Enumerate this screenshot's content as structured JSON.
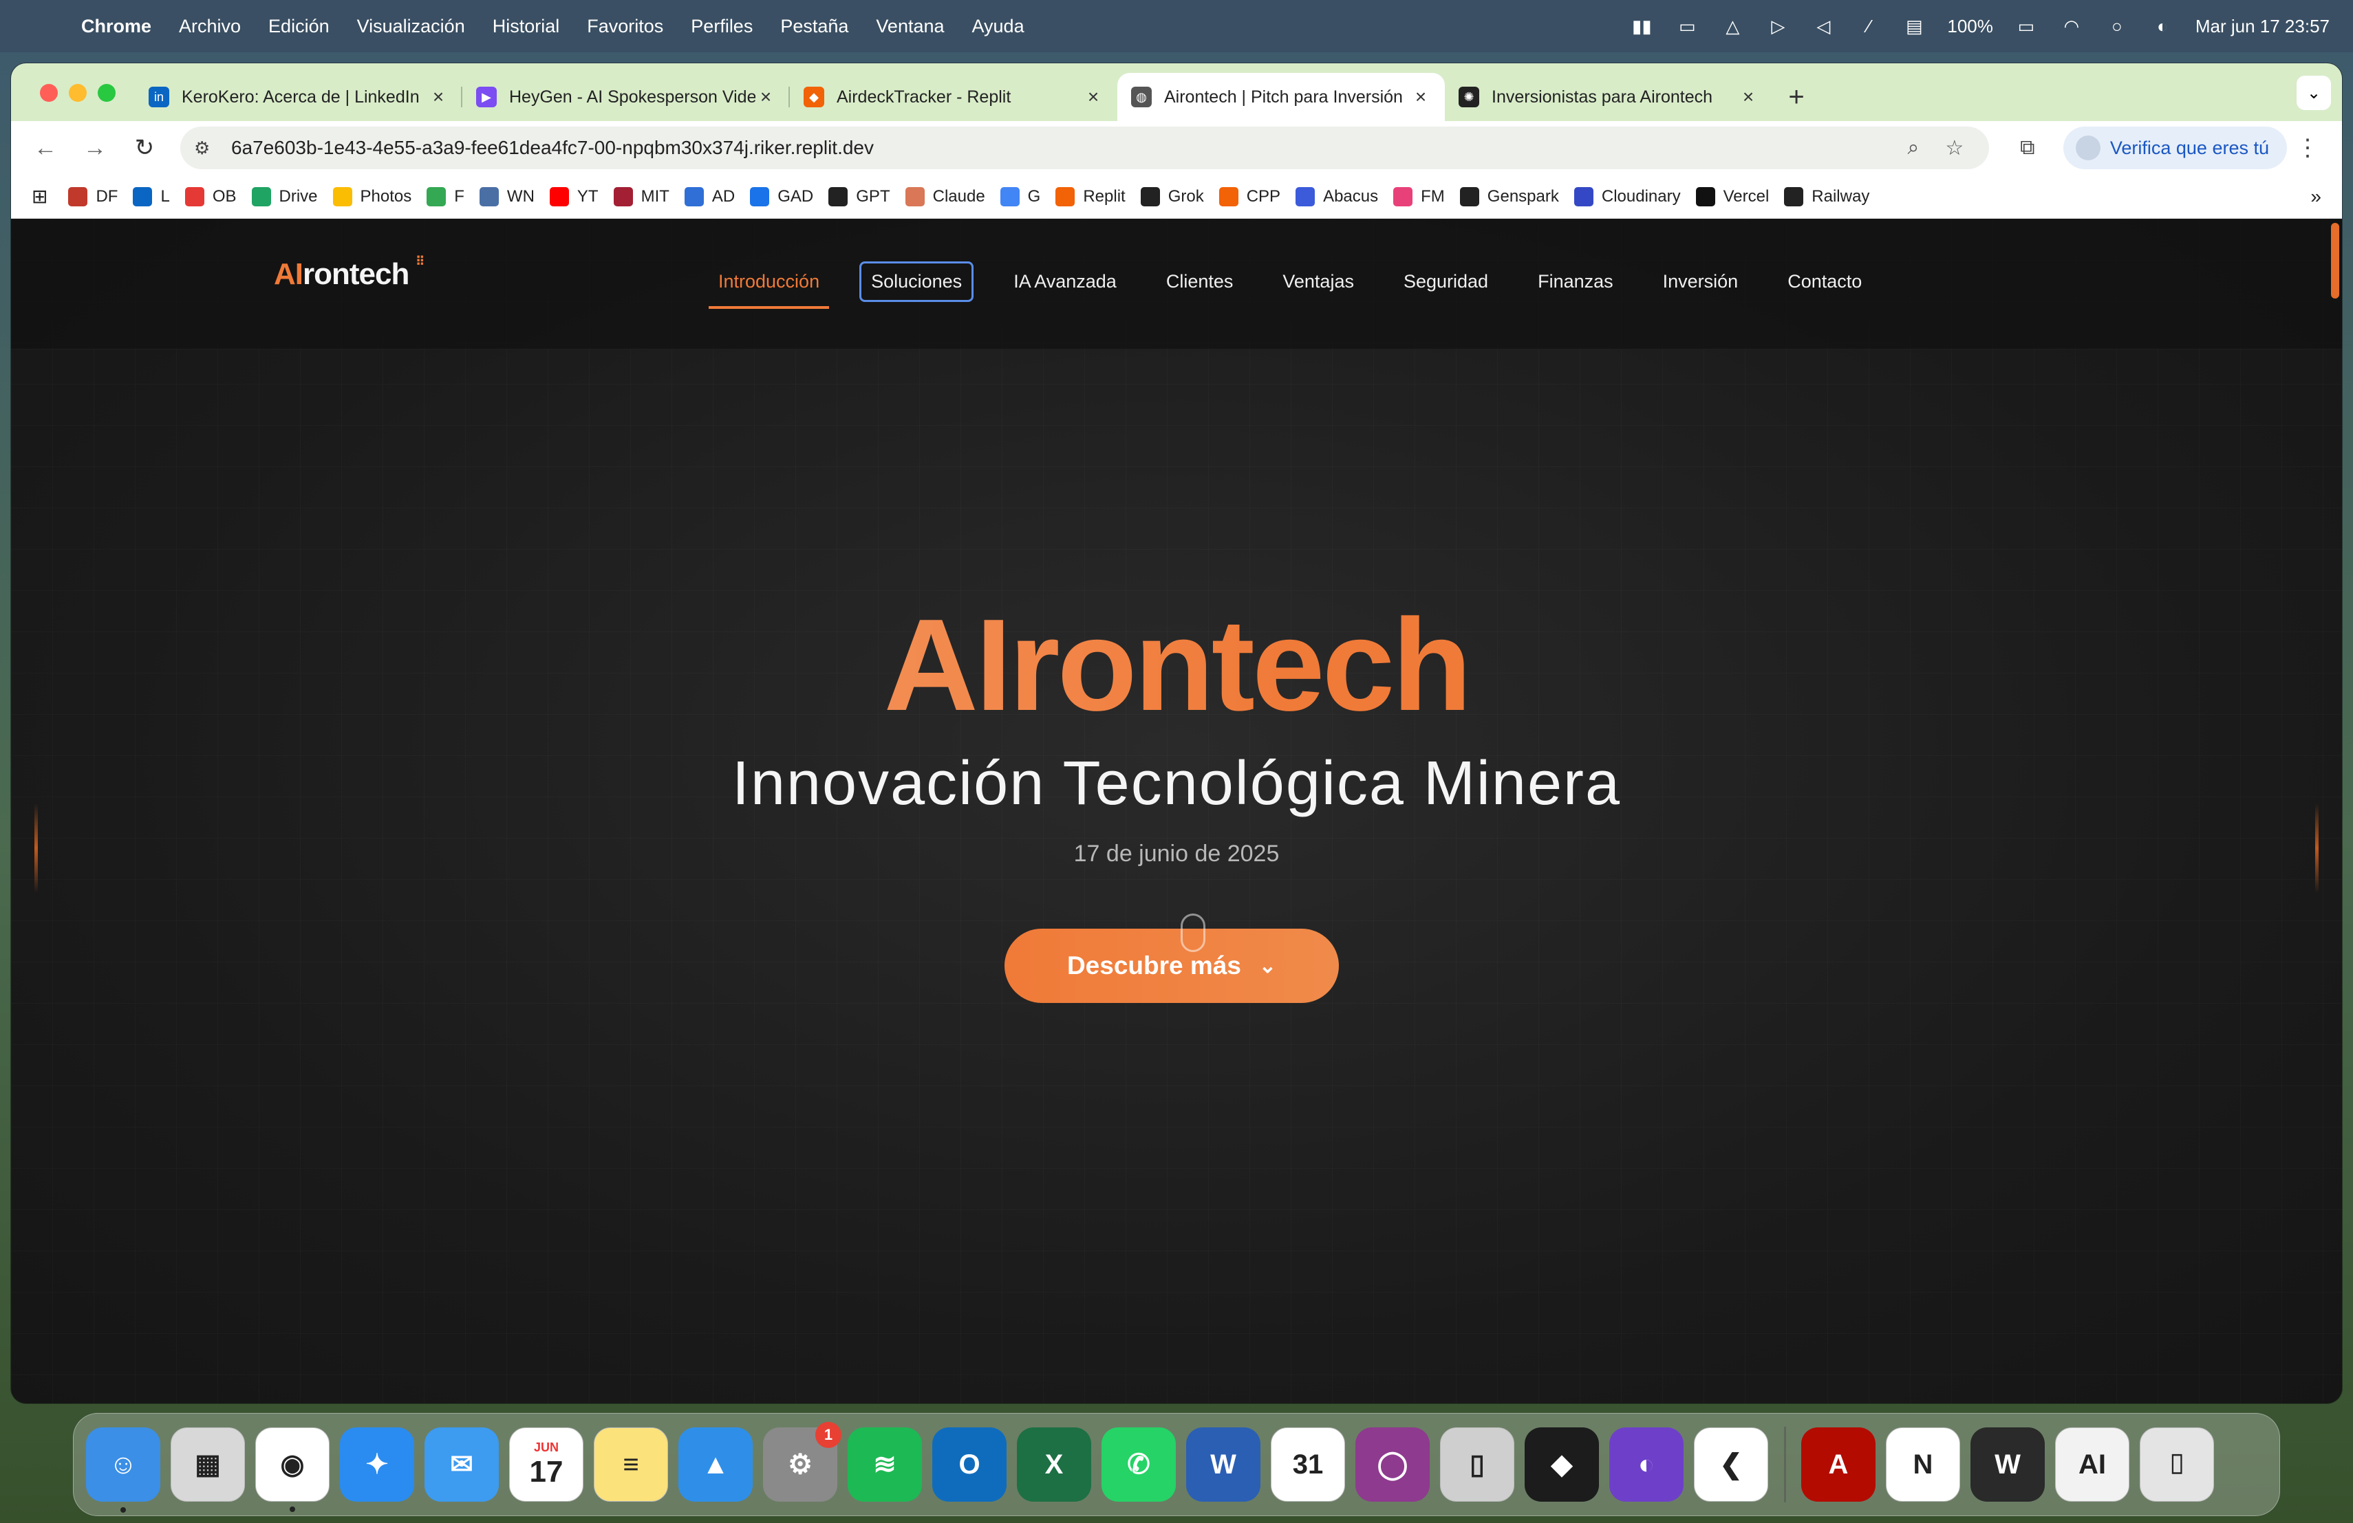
{
  "menubar": {
    "app": "Chrome",
    "items": [
      "Archivo",
      "Edición",
      "Visualización",
      "Historial",
      "Favoritos",
      "Perfiles",
      "Pestaña",
      "Ventana",
      "Ayuda"
    ],
    "battery": "100%",
    "datetime": "Mar jun 17  23:57"
  },
  "tabs": [
    {
      "title": "KeroKero: Acerca de | LinkedIn",
      "favicon": "linkedin-icon",
      "color": "#0a66c2",
      "glyph": "in"
    },
    {
      "title": "HeyGen - AI Spokesperson Video",
      "favicon": "heygen-icon",
      "color": "#7b4df2",
      "glyph": "▶"
    },
    {
      "title": "AirdeckTracker - Replit",
      "favicon": "replit-icon",
      "color": "#f26207",
      "glyph": "◆"
    },
    {
      "title": "Airontech | Pitch para Inversión",
      "favicon": "globe-icon",
      "color": "#555555",
      "glyph": "◍"
    },
    {
      "title": "Inversionistas para Airontech",
      "favicon": "openai-icon",
      "color": "#222222",
      "glyph": "✺"
    }
  ],
  "toolbar": {
    "url": "6a7e603b-1e43-4e55-a3a9-fee61dea4fc7-00-npqbm30x374j.riker.replit.dev",
    "verify_label": "Verifica que eres tú"
  },
  "bookmarks": [
    {
      "label": "DF",
      "color": "#c0392b"
    },
    {
      "label": "L",
      "color": "#0a66c2"
    },
    {
      "label": "OB",
      "color": "#e53935"
    },
    {
      "label": "Drive",
      "color": "#1fa463"
    },
    {
      "label": "Photos",
      "color": "#fbbc04"
    },
    {
      "label": "F",
      "color": "#34a853"
    },
    {
      "label": "WN",
      "color": "#4a6fa5"
    },
    {
      "label": "YT",
      "color": "#ff0000"
    },
    {
      "label": "MIT",
      "color": "#a31f34"
    },
    {
      "label": "AD",
      "color": "#2f6fd6"
    },
    {
      "label": "GAD",
      "color": "#1a73e8"
    },
    {
      "label": "GPT",
      "color": "#222222"
    },
    {
      "label": "Claude",
      "color": "#d97757"
    },
    {
      "label": "G",
      "color": "#4285f4"
    },
    {
      "label": "Replit",
      "color": "#f26207"
    },
    {
      "label": "Grok",
      "color": "#222222"
    },
    {
      "label": "CPP",
      "color": "#f26207"
    },
    {
      "label": "Abacus",
      "color": "#3b5bdb"
    },
    {
      "label": "FM",
      "color": "#e8417a"
    },
    {
      "label": "Genspark",
      "color": "#222222"
    },
    {
      "label": "Cloudinary",
      "color": "#3448c5"
    },
    {
      "label": "Vercel",
      "color": "#111111"
    },
    {
      "label": "Railway",
      "color": "#222222"
    }
  ],
  "site": {
    "logo_ai": "AI",
    "logo_rest": "rontech",
    "nav": [
      "Introducción",
      "Soluciones",
      "IA Avanzada",
      "Clientes",
      "Ventajas",
      "Seguridad",
      "Finanzas",
      "Inversión",
      "Contacto"
    ],
    "hero_title": "AIrontech",
    "hero_subtitle": "Innovación Tecnológica Minera",
    "hero_date": "17 de junio de 2025",
    "cta_label": "Descubre más"
  },
  "dock": [
    {
      "name": "finder-icon",
      "color": "#3b8fe6",
      "glyph": "☺",
      "running": true
    },
    {
      "name": "launchpad-icon",
      "color": "#d8d8d8",
      "glyph": "▦",
      "running": false
    },
    {
      "name": "chrome-icon",
      "color": "#ffffff",
      "glyph": "◉",
      "running": true
    },
    {
      "name": "safari-icon",
      "color": "#2a8cf0",
      "glyph": "✦",
      "running": false
    },
    {
      "name": "mail-icon",
      "color": "#3d9bf0",
      "glyph": "✉",
      "running": false
    },
    {
      "name": "calendar-icon",
      "color": "#ffffff",
      "glyph": "17",
      "month": "JUN",
      "running": false
    },
    {
      "name": "notes-icon",
      "color": "#fbe27a",
      "glyph": "≡",
      "running": false
    },
    {
      "name": "keynote-icon",
      "color": "#2f8fe8",
      "glyph": "▲",
      "running": false
    },
    {
      "name": "system-settings-icon",
      "color": "#8a8a8a",
      "glyph": "⚙",
      "badge": "1",
      "running": false
    },
    {
      "name": "spotify-icon",
      "color": "#1db954",
      "glyph": "≋",
      "running": false
    },
    {
      "name": "outlook-icon",
      "color": "#0f6cbd",
      "glyph": "O",
      "running": false
    },
    {
      "name": "excel-icon",
      "color": "#1d7044",
      "glyph": "X",
      "running": false
    },
    {
      "name": "whatsapp-icon",
      "color": "#25d366",
      "glyph": "✆",
      "running": false
    },
    {
      "name": "word-icon",
      "color": "#2b5fb4",
      "glyph": "W",
      "running": false
    },
    {
      "name": "calendar31-icon",
      "color": "#ffffff",
      "glyph": "31",
      "running": false
    },
    {
      "name": "screen-recorder-icon",
      "color": "#8e3a8e",
      "glyph": "◯",
      "running": false
    },
    {
      "name": "iphone-mirroring-icon",
      "color": "#cfcfcf",
      "glyph": "▯",
      "running": false
    },
    {
      "name": "replit-icon",
      "color": "#1c1c1c",
      "glyph": "◆",
      "running": false
    },
    {
      "name": "github-icon",
      "color": "#6e40c9",
      "glyph": "◐",
      "running": false
    },
    {
      "name": "vscode-icon",
      "color": "#ffffff",
      "glyph": "❮",
      "running": false
    },
    {
      "name": "acrobat-icon",
      "color": "#b30b00",
      "glyph": "A",
      "running": false
    },
    {
      "name": "notion-icon",
      "color": "#ffffff",
      "glyph": "N",
      "running": false
    },
    {
      "name": "webex-icon",
      "color": "#2a2a2a",
      "glyph": "W",
      "running": false
    },
    {
      "name": "document-preview-icon",
      "color": "#f2f2f2",
      "glyph": "AI",
      "running": false
    },
    {
      "name": "trash-icon",
      "color": "#e4e4e4",
      "glyph": "⌷",
      "running": false
    }
  ]
}
